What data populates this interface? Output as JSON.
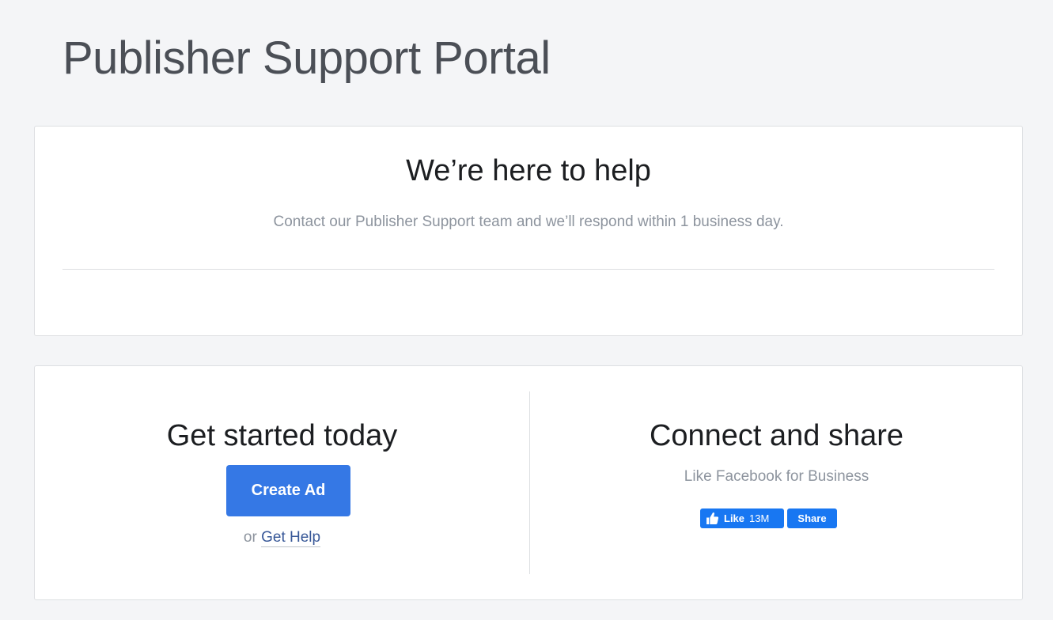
{
  "page": {
    "title": "Publisher Support Portal"
  },
  "help_card": {
    "heading": "We’re here to help",
    "subtitle": "Contact our Publisher Support team and we’ll respond within 1 business day."
  },
  "get_started": {
    "heading": "Get started today",
    "create_ad_label": "Create Ad",
    "or_text": "or",
    "get_help_label": "Get Help"
  },
  "connect": {
    "heading": "Connect and share",
    "subtitle": "Like Facebook for Business",
    "like_label": "Like",
    "like_count": "13M",
    "share_label": "Share"
  },
  "colors": {
    "background": "#f4f5f7",
    "accent": "#3578e5",
    "facebook_blue": "#1877f2",
    "link": "#385898"
  },
  "icons": {
    "like": "thumbs-up-icon"
  }
}
